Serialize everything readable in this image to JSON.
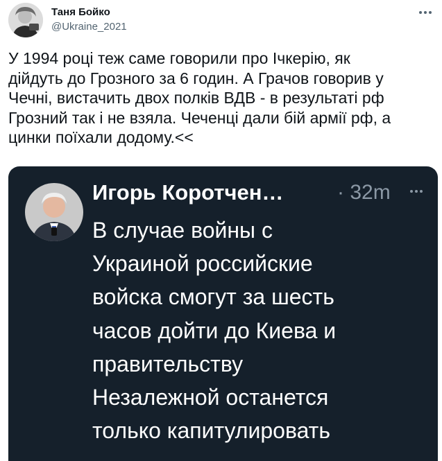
{
  "tweet": {
    "author_name": "Таня Бойко",
    "author_handle": "@Ukraine_2021",
    "text": "У 1994 році теж саме говорили про Ічкерію, як\nдійдуть до Грозного за 6 годин. А Грачов говорив у\nЧечні, вистачить двох полків ВДВ - в результаті рф\nГрозний так і не взяла. Чеченці дали бій армії рф, а\nцинки поїхали додому.<<",
    "avatar_icon": "user-avatar-icon",
    "more_icon": "more-options-icon"
  },
  "embedded_screenshot": {
    "author_name": "Игорь Коротчен…",
    "time": "· 32m",
    "text": "В случае войны с\nУкраиной российские\nвойска смогут за шесть\nчасов дойти до Киева и\nправительству\nНезалежной останется\nтолько капитулировать",
    "background_color": "#15202b",
    "text_color": "#ffffff",
    "muted_color": "#8b98a5"
  }
}
